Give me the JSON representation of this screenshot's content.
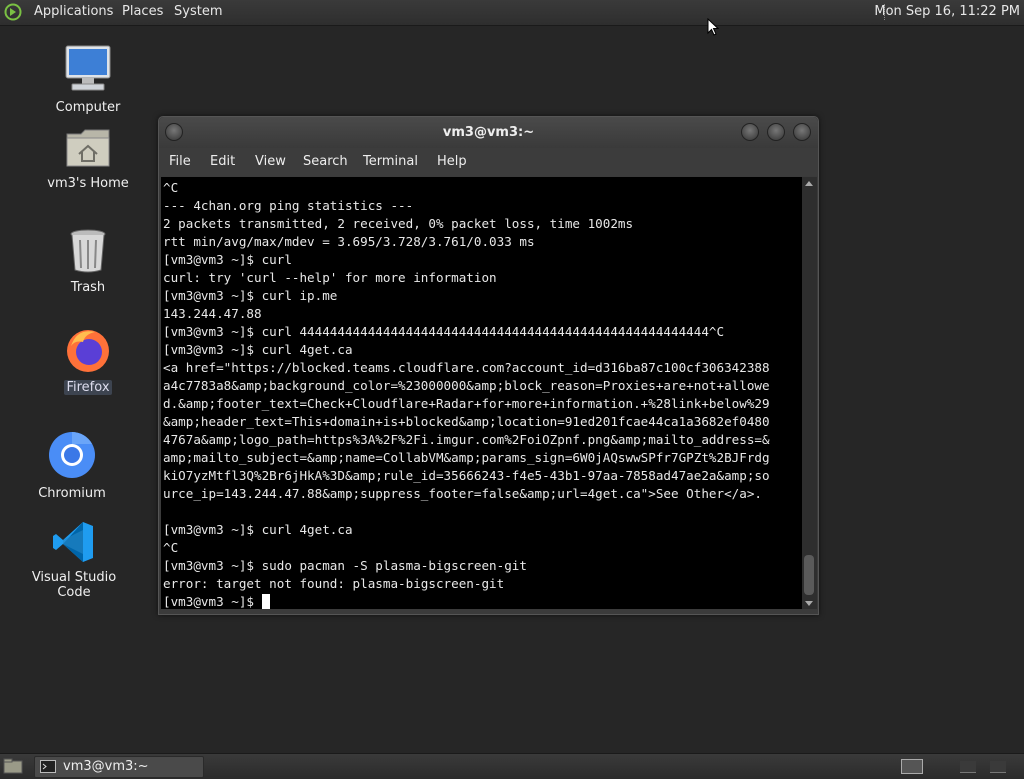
{
  "top_panel": {
    "menus": [
      "Applications",
      "Places",
      "System"
    ],
    "clock": "Mon Sep 16, 11:22 PM"
  },
  "desktop": {
    "icons": [
      {
        "label": "Computer",
        "icon": "computer-icon"
      },
      {
        "label": "vm3's Home",
        "icon": "home-folder-icon"
      },
      {
        "label": "Trash",
        "icon": "trash-icon"
      },
      {
        "label": "Firefox",
        "icon": "firefox-icon"
      },
      {
        "label": "Chromium",
        "icon": "chromium-icon"
      },
      {
        "label": "Visual Studio Code",
        "icon": "vscode-icon"
      }
    ]
  },
  "terminal": {
    "title": "vm3@vm3:~",
    "menu": [
      "File",
      "Edit",
      "View",
      "Search",
      "Terminal",
      "Help"
    ],
    "lines": [
      "^C",
      "--- 4chan.org ping statistics ---",
      "2 packets transmitted, 2 received, 0% packet loss, time 1002ms",
      "rtt min/avg/max/mdev = 3.695/3.728/3.761/0.033 ms",
      "[vm3@vm3 ~]$ curl",
      "curl: try 'curl --help' for more information",
      "[vm3@vm3 ~]$ curl ip.me",
      "143.244.47.88",
      "[vm3@vm3 ~]$ curl 444444444444444444444444444444444444444444444444444444^C",
      "[vm3@vm3 ~]$ curl 4get.ca",
      "<a href=\"https://blocked.teams.cloudflare.com?account_id=d316ba87c100cf306342388",
      "a4c7783a8&amp;background_color=%23000000&amp;block_reason=Proxies+are+not+allowe",
      "d.&amp;footer_text=Check+Cloudflare+Radar+for+more+information.+%28link+below%29",
      "&amp;header_text=This+domain+is+blocked&amp;location=91ed201fcae44ca1a3682ef0480",
      "4767a&amp;logo_path=https%3A%2F%2Fi.imgur.com%2FoiOZpnf.png&amp;mailto_address=&",
      "amp;mailto_subject=&amp;name=CollabVM&amp;params_sign=6W0jAQswwSPfr7GPZt%2BJFrdg",
      "kiO7yzMtfl3Q%2Br6jHkA%3D&amp;rule_id=35666243-f4e5-43b1-97aa-7858ad47ae2a&amp;so",
      "urce_ip=143.244.47.88&amp;suppress_footer=false&amp;url=4get.ca\">See Other</a>.",
      "",
      "[vm3@vm3 ~]$ curl 4get.ca",
      "^C",
      "[vm3@vm3 ~]$ sudo pacman -S plasma-bigscreen-git",
      "error: target not found: plasma-bigscreen-git"
    ],
    "prompt": "[vm3@vm3 ~]$ "
  },
  "taskbar": {
    "task_label": "vm3@vm3:~"
  },
  "colors": {
    "desktop_bg": "#262626",
    "panel_bg": "#333333",
    "terminal_bg": "#000000",
    "terminal_fg": "#e8e8e8"
  }
}
